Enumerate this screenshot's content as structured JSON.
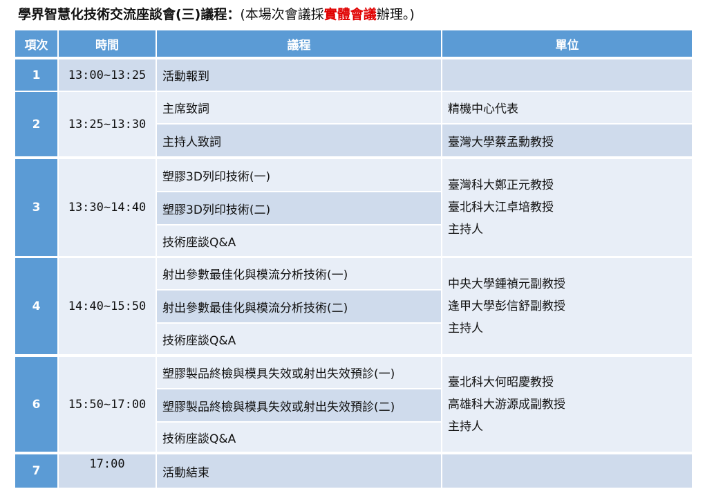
{
  "title": {
    "main": "學界智慧化技術交流座談會(三)議程：",
    "note_prefix": "(本場次會議採",
    "note_emphasis": "實體會議",
    "note_suffix": "辦理。)"
  },
  "headers": {
    "no": "項次",
    "time": "時間",
    "agenda": "議程",
    "unit": "單位"
  },
  "rows": [
    {
      "no": "1",
      "time": "13:00~13:25",
      "items": [
        "活動報到"
      ],
      "units": [
        ""
      ]
    },
    {
      "no": "2",
      "time": "13:25~13:30",
      "items": [
        "主席致詞",
        "主持人致詞"
      ],
      "units": [
        "精機中心代表",
        "臺灣大學蔡孟勳教授"
      ]
    },
    {
      "no": "3",
      "time": "13:30~14:40",
      "items": [
        "塑膠3D列印技術(一)",
        "塑膠3D列印技術(二)",
        "技術座談Q&A"
      ],
      "units": [
        "臺灣科大鄭正元教授",
        "臺北科大江卓培教授",
        "主持人"
      ]
    },
    {
      "no": "4",
      "time": "14:40~15:50",
      "items": [
        "射出參數最佳化與模流分析技術(一)",
        "射出參數最佳化與模流分析技術(二)",
        "技術座談Q&A"
      ],
      "units": [
        "中央大學鍾禎元副教授",
        "逢甲大學彭信舒副教授",
        "主持人"
      ]
    },
    {
      "no": "6",
      "time": "15:50~17:00",
      "items": [
        "塑膠製品終檢與模具失效或射出失效預診(一)",
        "塑膠製品終檢與模具失效或射出失效預診(二)",
        "技術座談Q&A"
      ],
      "units": [
        "臺北科大何昭慶教授",
        "高雄科大游源成副教授",
        "主持人"
      ]
    },
    {
      "no": "7",
      "time": "17:00",
      "items": [
        "活動結束"
      ],
      "units": [
        ""
      ]
    }
  ],
  "colors": {
    "header_bg": "#5b9bd5",
    "row_dark": "#cfdbec",
    "row_light": "#e8eef7",
    "emphasis": "#e00000"
  }
}
